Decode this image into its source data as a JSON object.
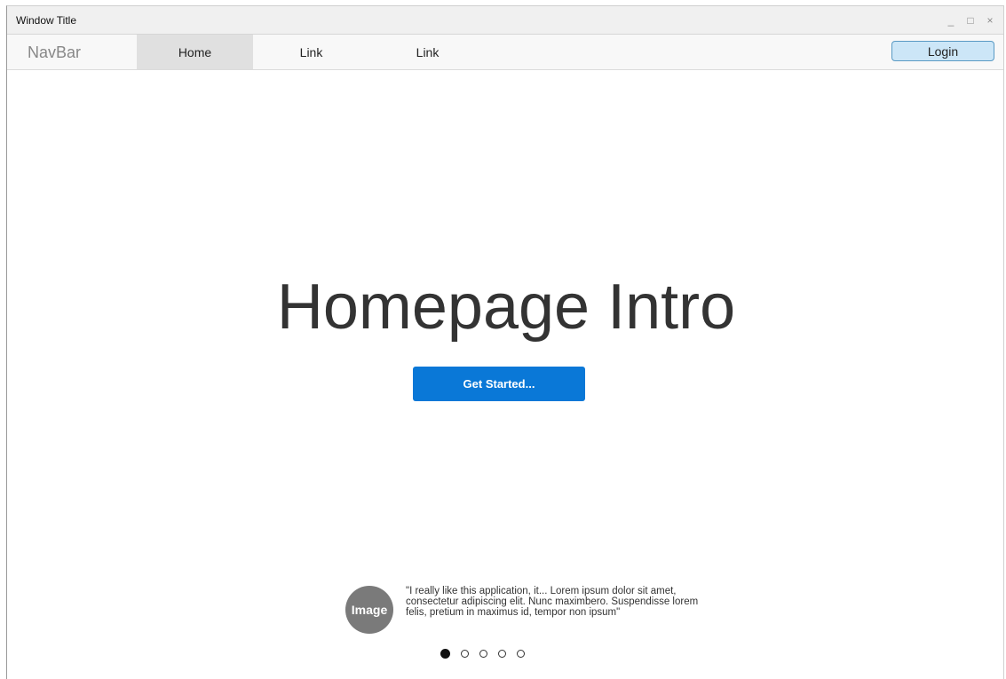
{
  "window": {
    "title": "Window Title",
    "minimize_icon": "_",
    "maximize_icon": "□",
    "close_icon": "×"
  },
  "navbar": {
    "brand": "NavBar",
    "items": [
      {
        "label": "Home",
        "active": true
      },
      {
        "label": "Link",
        "active": false
      },
      {
        "label": "Link",
        "active": false
      }
    ],
    "login_label": "Login"
  },
  "hero": {
    "title": "Homepage Intro",
    "cta_label": "Get Started..."
  },
  "testimonial": {
    "avatar_label": "Image",
    "quote": "\"I really like this application, it...  Lorem ipsum dolor sit amet, consectetur adipiscing elit. Nunc maximbero. Suspendisse lorem felis, pretium in maximus id, tempor non ipsum\""
  },
  "carousel": {
    "total": 5,
    "active_index": 0
  },
  "colors": {
    "accent": "#0a78d7",
    "login_bg": "#cce6f7",
    "avatar": "#7a7a7a"
  }
}
